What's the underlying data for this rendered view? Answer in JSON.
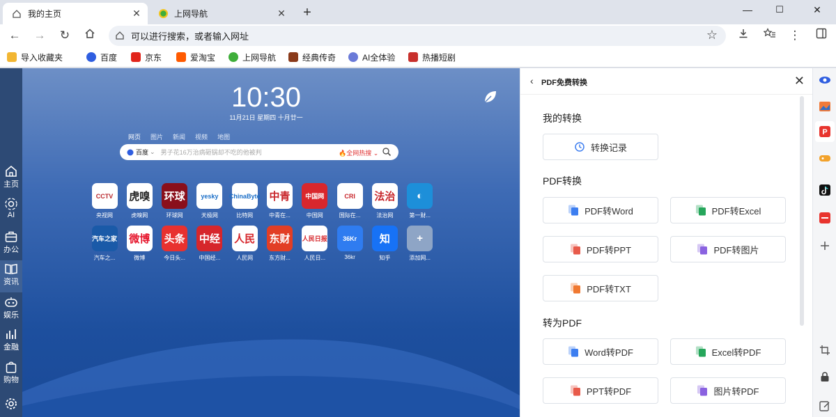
{
  "tabs": [
    {
      "title": "我的主页",
      "active": true
    },
    {
      "title": "上网导航",
      "active": false
    }
  ],
  "window": {
    "minimize": "—",
    "maximize": "☐",
    "close": "✕"
  },
  "omnibox": {
    "placeholder": "可以进行搜索，或者输入网址"
  },
  "bookmarks": [
    {
      "label": "导入收藏夹",
      "color": "#f2b632"
    },
    {
      "label": "百度",
      "color": "#2f5ee0"
    },
    {
      "label": "京东",
      "color": "#e1251b"
    },
    {
      "label": "爱淘宝",
      "color": "#ff5a00"
    },
    {
      "label": "上网导航",
      "color": "#3fae3a"
    },
    {
      "label": "经典传奇",
      "color": "#8a3a1a"
    },
    {
      "label": "AI全体验",
      "color": "#6a7ad8"
    },
    {
      "label": "热播短剧",
      "color": "#c8302c"
    }
  ],
  "left_rail": [
    {
      "label": "主页",
      "icon": "home-icon"
    },
    {
      "label": "AI",
      "icon": "ai-icon"
    },
    {
      "label": "办公",
      "icon": "briefcase-icon"
    },
    {
      "label": "资讯",
      "icon": "book-icon",
      "selected": true
    },
    {
      "label": "娱乐",
      "icon": "gamepad-icon"
    },
    {
      "label": "金融",
      "icon": "chart-icon"
    },
    {
      "label": "购物",
      "icon": "bag-icon"
    }
  ],
  "newtab": {
    "time": "10:30",
    "date": "11月21日 星期四 十月廿一",
    "search_tabs": [
      "网页",
      "图片",
      "新闻",
      "视频",
      "地图"
    ],
    "engine": "百度",
    "search_placeholder": "男子花16万治病砸锅却不吃的他被判",
    "hot_label": "全网热搜",
    "tiles_row1": [
      {
        "label": "央视网",
        "text": "CCTV",
        "bg": "#ffffff",
        "fg": "#b8262b"
      },
      {
        "label": "虎嗅网",
        "text": "虎嗅",
        "bg": "#ffffff",
        "fg": "#222222"
      },
      {
        "label": "环球网",
        "text": "环球",
        "bg": "#8a0f1b",
        "fg": "#ffffff"
      },
      {
        "label": "天极网",
        "text": "yesky",
        "bg": "#ffffff",
        "fg": "#1b6fc8"
      },
      {
        "label": "比特网",
        "text": "ChinaByte",
        "bg": "#ffffff",
        "fg": "#1b6fc8"
      },
      {
        "label": "中青在...",
        "text": "中青",
        "bg": "#ffffff",
        "fg": "#c8262b"
      },
      {
        "label": "中国网",
        "text": "中国网",
        "bg": "#d9272d",
        "fg": "#ffffff"
      },
      {
        "label": "国际在...",
        "text": "CRI",
        "bg": "#ffffff",
        "fg": "#c8262b"
      },
      {
        "label": "法治网",
        "text": "法治",
        "bg": "#ffffff",
        "fg": "#c8262b"
      },
      {
        "label": "第一财...",
        "text": "◐",
        "bg": "#1d8fd9",
        "fg": "#ffffff"
      }
    ],
    "tiles_row2": [
      {
        "label": "汽车之...",
        "text": "汽车之家",
        "bg": "#1a5aa8",
        "fg": "#ffffff"
      },
      {
        "label": "微博",
        "text": "微博",
        "bg": "#ffffff",
        "fg": "#e6162d"
      },
      {
        "label": "今日头...",
        "text": "头条",
        "bg": "#e8312f",
        "fg": "#ffffff"
      },
      {
        "label": "中国经...",
        "text": "中经",
        "bg": "#d6262b",
        "fg": "#ffffff"
      },
      {
        "label": "人民网",
        "text": "人民",
        "bg": "#ffffff",
        "fg": "#d6262b"
      },
      {
        "label": "东方财...",
        "text": "东财",
        "bg": "#e23e25",
        "fg": "#ffffff"
      },
      {
        "label": "人民日...",
        "text": "人民日报",
        "bg": "#ffffff",
        "fg": "#d6262b"
      },
      {
        "label": "36kr",
        "text": "36Kr",
        "bg": "#2f7cf0",
        "fg": "#ffffff"
      },
      {
        "label": "知乎",
        "text": "知",
        "bg": "#1772f6",
        "fg": "#ffffff"
      },
      {
        "label": "添加网...",
        "text": "+",
        "bg": "#8ea5c6",
        "fg": "#ffffff"
      }
    ]
  },
  "panel": {
    "title": "PDF免费转换",
    "section1": "我的转换",
    "record_button": "转换记录",
    "section2": "PDF转换",
    "pdf_buttons": [
      {
        "label": "PDF转Word",
        "color": "#3d7ef0"
      },
      {
        "label": "PDF转Excel",
        "color": "#26a65b"
      },
      {
        "label": "PDF转PPT",
        "color": "#e85a4a"
      },
      {
        "label": "PDF转图片",
        "color": "#8a62e0"
      },
      {
        "label": "PDF转TXT",
        "color": "#f07830"
      }
    ],
    "section3": "转为PDF",
    "to_pdf_buttons": [
      {
        "label": "Word转PDF",
        "color": "#3d7ef0"
      },
      {
        "label": "Excel转PDF",
        "color": "#26a65b"
      },
      {
        "label": "PPT转PDF",
        "color": "#e85a4a"
      },
      {
        "label": "图片转PDF",
        "color": "#8a62e0"
      }
    ]
  }
}
